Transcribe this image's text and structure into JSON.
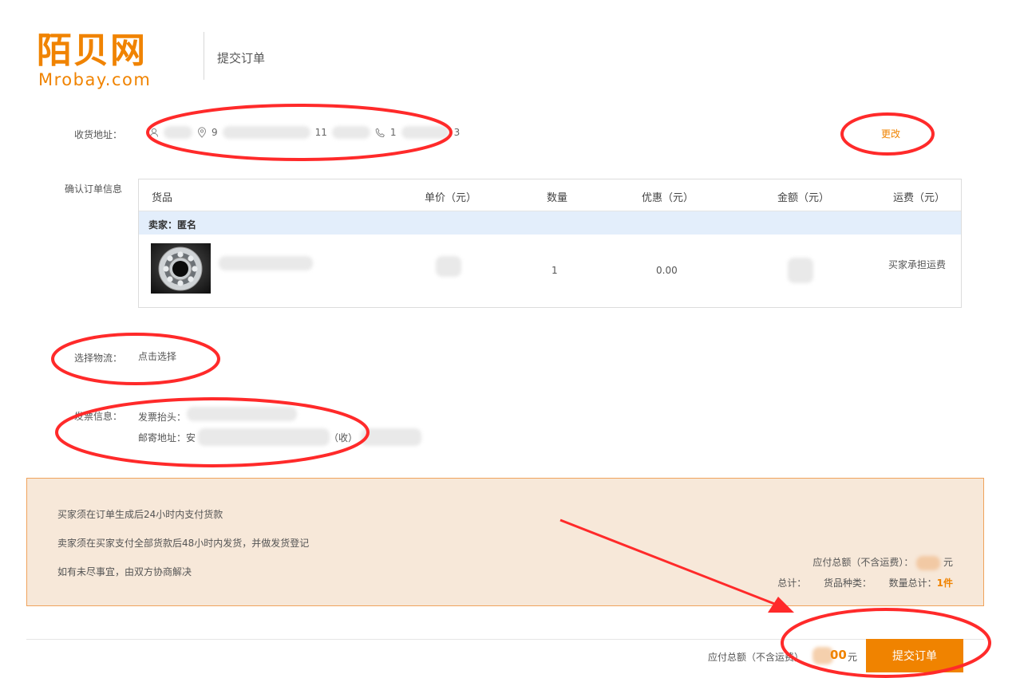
{
  "header": {
    "logo_cn": "陌贝网",
    "logo_en": "Mrobay.com",
    "page_title": "提交订单"
  },
  "address": {
    "label": "收货地址：",
    "icons": [
      "person-icon",
      "location-icon",
      "phone-icon"
    ],
    "partial_name": "9",
    "partial_mid": "11",
    "partial_phone_start": "1",
    "partial_phone_end": "3",
    "change_label": "更改"
  },
  "order": {
    "label": "确认订单信息",
    "columns": [
      "货品",
      "单价（元）",
      "数量",
      "优惠（元）",
      "金额（元）",
      "运费（元）"
    ],
    "seller": "卖家：匿名",
    "item": {
      "quantity": "1",
      "discount": "0.00",
      "shipping": "买家承担运费"
    }
  },
  "logistics": {
    "label": "选择物流：",
    "value": "点击选择"
  },
  "invoice": {
    "label": "发票信息：",
    "title_label": "发票抬头：",
    "mail_label": "邮寄地址：安",
    "mail_suffix": "（收）"
  },
  "notice": {
    "lines": [
      "买家须在订单生成后24小时内支付货款",
      "卖家须在买家支付全部货款后48小时内发货，并做发货登记",
      "如有未尽事宜，由双方协商解决"
    ],
    "total_label": "应付总额（不含运费）：",
    "total_unit": "元",
    "count_label": "总计：",
    "kinds_label": "货品种类：",
    "qty_label": "数量总计：",
    "qty_value": "1件"
  },
  "footer": {
    "total_label": "应付总额（不含运费）",
    "amount_partial": "00",
    "unit": "元",
    "submit_label": "提交订单"
  },
  "colors": {
    "brand": "#f08300",
    "annotation": "#ff2a2a"
  }
}
